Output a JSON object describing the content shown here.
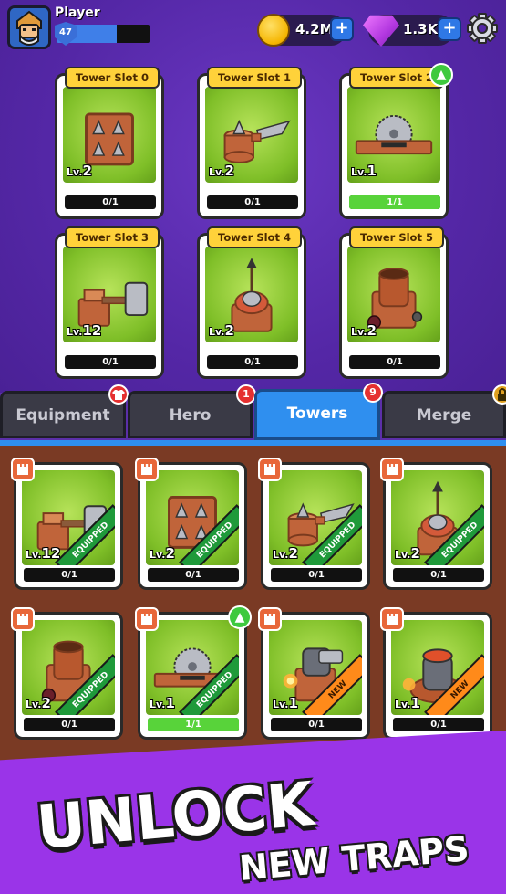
{
  "player": {
    "name": "Player",
    "level": "47",
    "xp_fraction": 0.65
  },
  "currency": {
    "coins": {
      "value": "4.2M",
      "icon": "coin-icon"
    },
    "gems": {
      "value": "1.3K",
      "icon": "gem-icon"
    }
  },
  "slots": [
    {
      "title": "Tower Slot 0",
      "level": "2",
      "progress": "0/1",
      "fill": 0,
      "art": "spike-block"
    },
    {
      "title": "Tower Slot 1",
      "level": "2",
      "progress": "0/1",
      "fill": 0,
      "art": "blade-stump"
    },
    {
      "title": "Tower Slot 2",
      "level": "1",
      "progress": "1/1",
      "fill": 1,
      "art": "saw-plank",
      "upgrade": true
    },
    {
      "title": "Tower Slot 3",
      "level": "12",
      "progress": "0/1",
      "fill": 0,
      "art": "hammer"
    },
    {
      "title": "Tower Slot 4",
      "level": "2",
      "progress": "0/1",
      "fill": 0,
      "art": "arrow-turret"
    },
    {
      "title": "Tower Slot 5",
      "level": "2",
      "progress": "0/1",
      "fill": 0,
      "art": "barrel-cannon"
    }
  ],
  "tabs": [
    {
      "label": "Equipment",
      "badge": "shirt-icon",
      "active": false
    },
    {
      "label": "Hero",
      "badge": "1",
      "active": false
    },
    {
      "label": "Towers",
      "badge": "9",
      "active": true
    },
    {
      "label": "Merge",
      "badge": "lock-icon",
      "active": false
    }
  ],
  "inventory": [
    {
      "level": "12",
      "progress": "0/1",
      "fill": 0,
      "ribbon": "EQUIPPED",
      "art": "hammer"
    },
    {
      "level": "2",
      "progress": "0/1",
      "fill": 0,
      "ribbon": "EQUIPPED",
      "art": "spike-block"
    },
    {
      "level": "2",
      "progress": "0/1",
      "fill": 0,
      "ribbon": "EQUIPPED",
      "art": "blade-stump"
    },
    {
      "level": "2",
      "progress": "0/1",
      "fill": 0,
      "ribbon": "EQUIPPED",
      "art": "arrow-turret"
    },
    {
      "level": "2",
      "progress": "0/1",
      "fill": 0,
      "ribbon": "EQUIPPED",
      "art": "barrel-cannon"
    },
    {
      "level": "1",
      "progress": "1/1",
      "fill": 1,
      "ribbon": "EQUIPPED",
      "art": "saw-plank",
      "upgrade": true
    },
    {
      "level": "1",
      "progress": "0/1",
      "fill": 0,
      "ribbon": "NEW",
      "art": "fire-cannon"
    },
    {
      "level": "1",
      "progress": "0/1",
      "fill": 0,
      "ribbon": "NEW",
      "art": "fire-mortar"
    }
  ],
  "banner": {
    "line1": "UNLOCK",
    "line2": "NEW TRAPS"
  },
  "colors": {
    "accent": "#2f8fef",
    "card_bg": "#7fbf28",
    "title_yellow": "#ffd23a",
    "equipped": "#1f9a3a",
    "new": "#ff8a1a"
  }
}
